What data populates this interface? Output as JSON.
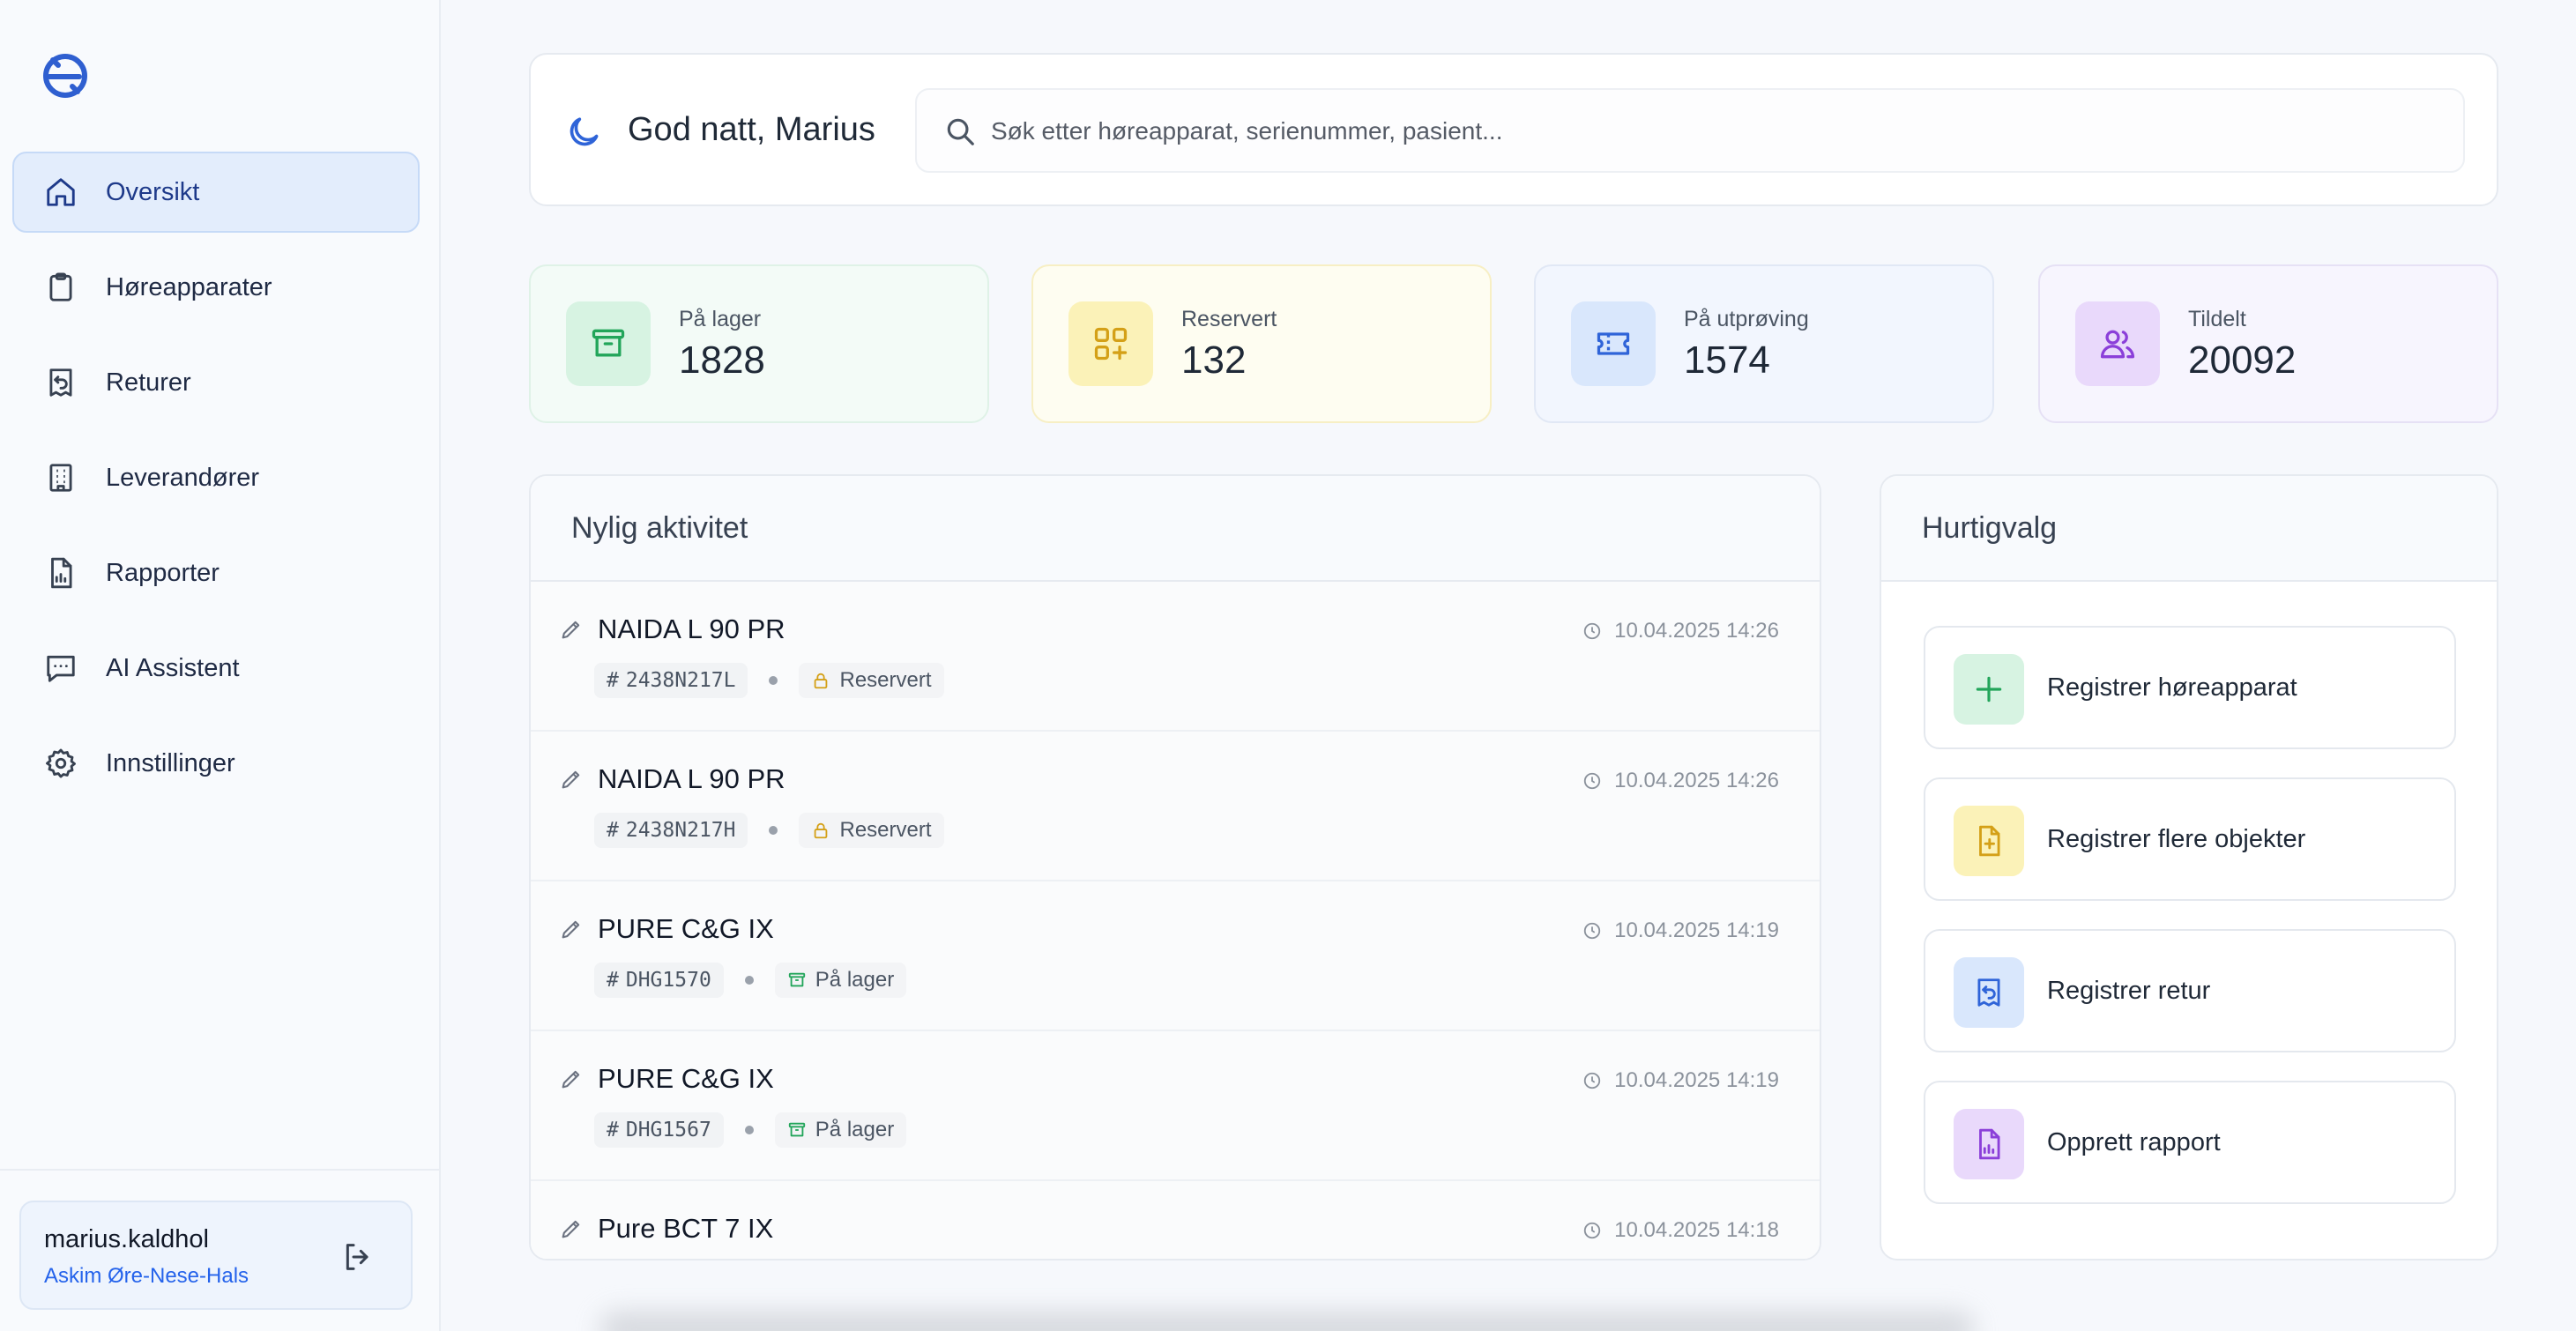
{
  "colors": {
    "primary": "#2563eb",
    "nav_active_bg": "#e3edfc",
    "green": "#22a55a",
    "yellow": "#d4a017",
    "blue": "#2f64d8",
    "purple": "#8b3fd9"
  },
  "sidebar": {
    "logo_icon": "app-logo-icon",
    "items": [
      {
        "label": "Oversikt",
        "icon": "home-icon",
        "active": true
      },
      {
        "label": "Høreapparater",
        "icon": "clipboard-icon",
        "active": false
      },
      {
        "label": "Returer",
        "icon": "receipt-return-icon",
        "active": false
      },
      {
        "label": "Leverandører",
        "icon": "building-icon",
        "active": false
      },
      {
        "label": "Rapporter",
        "icon": "file-chart-icon",
        "active": false
      },
      {
        "label": "AI Assistent",
        "icon": "chat-icon",
        "active": false
      },
      {
        "label": "Innstillinger",
        "icon": "gear-icon",
        "active": false
      }
    ],
    "user": {
      "name": "marius.kaldhol",
      "organization": "Askim Øre-Nese-Hals",
      "logout_icon": "logout-icon"
    }
  },
  "header": {
    "greeting_icon": "moon-icon",
    "greeting": "God natt, Marius",
    "search_placeholder": "Søk etter høreapparat, serienummer, pasient..."
  },
  "stats": [
    {
      "label": "På lager",
      "value": "1828",
      "icon": "archive-icon"
    },
    {
      "label": "Reservert",
      "value": "132",
      "icon": "shapes-icon"
    },
    {
      "label": "På utprøving",
      "value": "1574",
      "icon": "ticket-icon"
    },
    {
      "label": "Tildelt",
      "value": "20092",
      "icon": "users-icon"
    }
  ],
  "activity": {
    "title": "Nylig aktivitet",
    "items": [
      {
        "name": "NAIDA L 90 PR",
        "serial": "2438N217L",
        "status": "Reservert",
        "time": "10.04.2025 14:26"
      },
      {
        "name": "NAIDA L 90 PR",
        "serial": "2438N217H",
        "status": "Reservert",
        "time": "10.04.2025 14:26"
      },
      {
        "name": "PURE C&G IX",
        "serial": "DHG1570",
        "status": "På lager",
        "time": "10.04.2025 14:19"
      },
      {
        "name": "PURE C&G IX",
        "serial": "DHG1567",
        "status": "På lager",
        "time": "10.04.2025 14:19"
      },
      {
        "name": "Pure BCT 7 IX",
        "serial": "",
        "status": "",
        "time": "10.04.2025 14:18"
      }
    ]
  },
  "quick_actions": {
    "title": "Hurtigvalg",
    "items": [
      {
        "label": "Registrer høreapparat",
        "icon": "plus-icon"
      },
      {
        "label": "Registrer flere objekter",
        "icon": "file-plus-icon"
      },
      {
        "label": "Registrer retur",
        "icon": "receipt-return-icon"
      },
      {
        "label": "Opprett rapport",
        "icon": "file-chart-icon"
      }
    ]
  }
}
